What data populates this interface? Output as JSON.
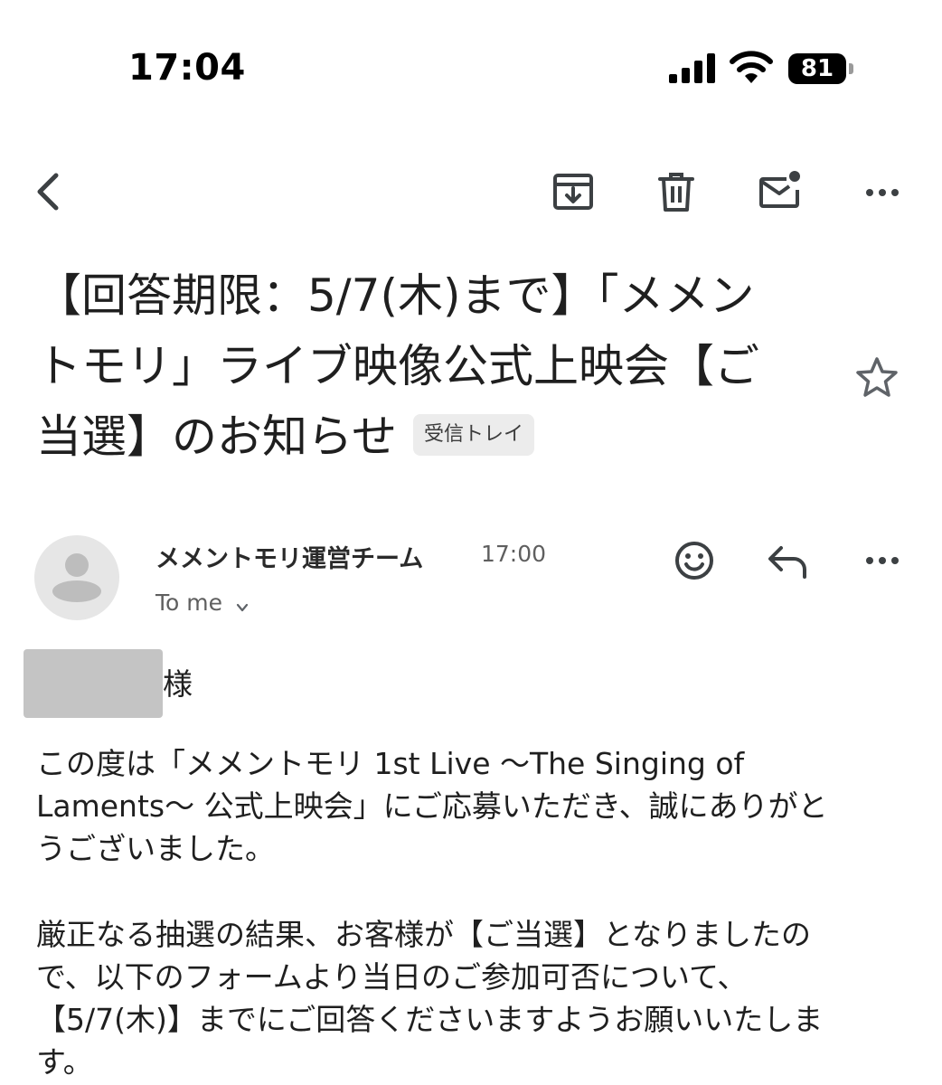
{
  "status_bar": {
    "time": "17:04",
    "battery": "81"
  },
  "subject": {
    "lines": [
      "【回答期限：5/7(木)まで】「メメン",
      "トモリ」ライブ映像公式上映会【ご",
      "当選】のお知らせ"
    ],
    "label": "受信トレイ"
  },
  "sender": {
    "name": "メメントモリ運営チーム",
    "time": "17:00",
    "to": "To me"
  },
  "body": {
    "salutation_suffix": "様",
    "paragraph1": [
      "この度は「メメントモリ 1st Live 〜The Singing of",
      "Laments〜 公式上映会」にご応募いただき、誠にありがと",
      "うございました。"
    ],
    "paragraph2": [
      "厳正なる抽選の結果、お客様が【ご当選】となりましたの",
      "で、以下のフォームより当日のご参加可否について、",
      "【5/7(木)】までにご回答くださいますようお願いいたしま",
      "す。"
    ]
  },
  "icons": {
    "toolbar": [
      "back-icon",
      "archive-icon",
      "delete-icon",
      "mark-unread-icon",
      "more-icon"
    ],
    "sender_actions": [
      "emoji-reaction-icon",
      "reply-icon",
      "more-icon"
    ]
  },
  "colors": {
    "icon": "#3c4043",
    "chip_bg": "#ececec",
    "avatar_bg": "#e6e6e6",
    "redaction": "#c4c4c4"
  }
}
